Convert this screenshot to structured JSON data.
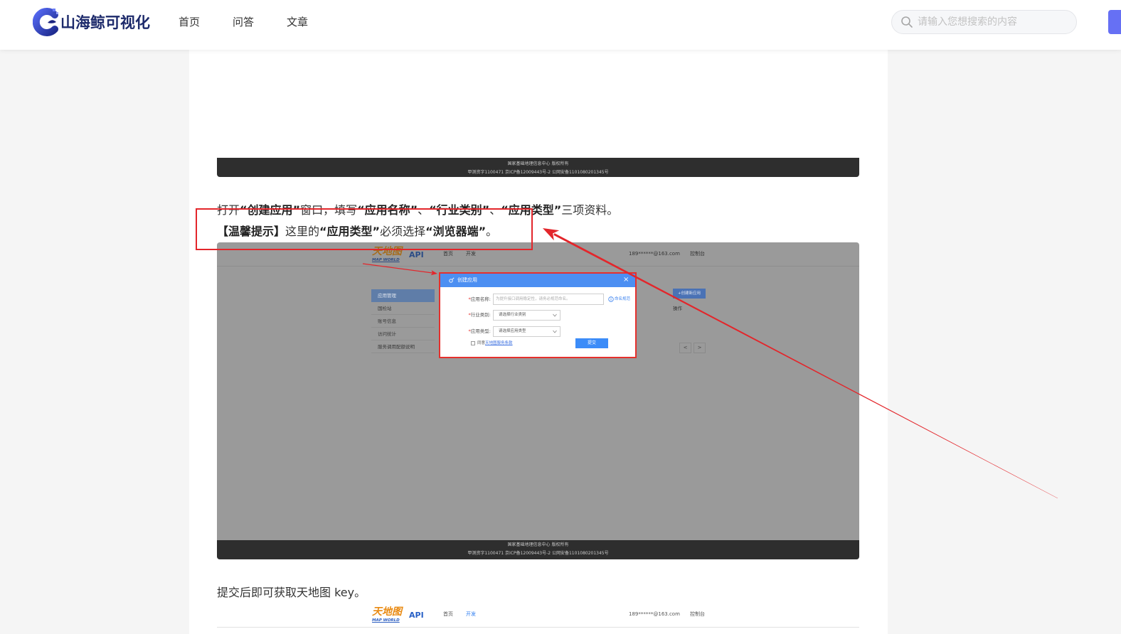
{
  "site": {
    "name": "山海鲸可视化",
    "nav": [
      {
        "label": "首页"
      },
      {
        "label": "问答"
      },
      {
        "label": "文章"
      }
    ],
    "search": {
      "placeholder": "请输入您想搜索的内容"
    },
    "colors": {
      "brand_text": "#1d2a6b",
      "action_button": "#6670f4",
      "page_background": "#f5f5f5"
    }
  },
  "article": {
    "screenshot1": {
      "footer_line1": "国家基础地理信息中心 版权所有",
      "footer_line2": "甲测资字1100471 京ICP备12009443号-2 公网安备1101080201345号"
    },
    "paragraph1": [
      "打开",
      "“创建应用”",
      "窗口，填写",
      "“应用名称”",
      "、",
      "“行业类别”",
      "、",
      "“应用类型”",
      "三项资料。"
    ],
    "paragraph2": [
      "【温馨提示】",
      "这里的",
      "“应用类型”",
      "必须选择",
      "“浏览器端”",
      "。"
    ],
    "screenshot2": {
      "logo_cn": "天地图",
      "logo_en": "MAP WORLD",
      "api_label": "API",
      "nav": [
        "首页",
        "开发"
      ],
      "account": "189******@163.com",
      "console": "控制台",
      "sidebar": [
        "应用管理",
        "国检站",
        "账号信息",
        "访问统计",
        "服务调用配额说明"
      ],
      "create_button": "+创建新应用",
      "column_header": "操作",
      "pager": [
        "<",
        ">"
      ],
      "modal": {
        "title": "创建应用",
        "close": "×",
        "required_mark": "*",
        "name_label": "应用名称:",
        "name_placeholder": "为提升接口调用稳定性，请务必规范命名。",
        "naming_link": "命名规范",
        "industry_label": "行业类别:",
        "industry_value": "请选择行业类别",
        "type_label": "应用类型:",
        "type_value": "请选择应用类型",
        "agree_text": "同意",
        "agree_link": "天地图服务条款",
        "submit": "提交"
      },
      "footer_line1": "国家基础地理信息中心 版权所有",
      "footer_line2": "甲测资字1100471 京ICP备12009443号-2 公网安备1101080201345号"
    },
    "paragraph3": "提交后即可获取天地图 key。",
    "screenshot3": {
      "logo_cn": "天地图",
      "logo_en": "MAP WORLD",
      "api_label": "API",
      "nav": [
        "首页",
        "开发"
      ],
      "account": "189******@163.com",
      "console": "控制台"
    },
    "annotation_color": "#e3262b"
  }
}
